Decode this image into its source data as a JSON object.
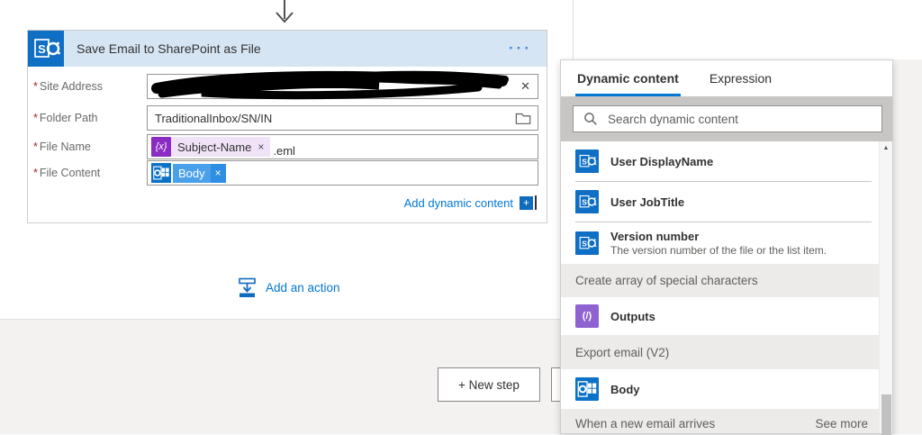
{
  "icons": {
    "ellipsis": "···",
    "clear": "✕",
    "plus": "+",
    "scroll_up": "▲",
    "outputs_glyph": "(/)",
    "fx_chip": "{x}",
    "remove_x": "×"
  },
  "canvas": {
    "card": {
      "title": "Save Email to SharePoint as File",
      "required_mark": "*",
      "fields": [
        {
          "label": "Site Address",
          "value_redacted": true
        },
        {
          "label": "Folder Path",
          "value": "TraditionalInbox/SN/IN"
        },
        {
          "label": "File Name",
          "token_label": "Subject-Name",
          "suffix": ".eml"
        },
        {
          "label": "File Content",
          "token_label": "Body"
        }
      ],
      "add_dynamic_label": "Add dynamic content"
    },
    "add_action_label": "Add an action",
    "new_step_label": "+ New step"
  },
  "panel": {
    "tabs": [
      {
        "label": "Dynamic content",
        "active": true
      },
      {
        "label": "Expression",
        "active": false
      }
    ],
    "search_placeholder": "Search dynamic content",
    "list": [
      {
        "kind": "item",
        "icon": "sharepoint-icon",
        "label": "User DisplayName"
      },
      {
        "kind": "item",
        "icon": "sharepoint-icon",
        "label": "User JobTitle"
      },
      {
        "kind": "item",
        "icon": "sharepoint-icon",
        "label": "Version number",
        "desc": "The version number of the file or the list item."
      },
      {
        "kind": "section",
        "label": "Create array of special characters"
      },
      {
        "kind": "item",
        "icon": "outputs-icon",
        "label": "Outputs"
      },
      {
        "kind": "section",
        "label": "Export email (V2)"
      },
      {
        "kind": "item",
        "icon": "outlook-icon",
        "label": "Body"
      },
      {
        "kind": "section",
        "label": "When a new email arrives",
        "action": "See more"
      }
    ]
  },
  "colors": {
    "accent": "#0078d4",
    "sharepoint_blue": "#0f6fc5",
    "outlook_blue": "#0a72c7",
    "expression_purple": "#8a2bc2",
    "outputs_purple": "#8e62d0",
    "card_header_bg": "#d6e5f4",
    "section_bg": "#edebe9"
  }
}
